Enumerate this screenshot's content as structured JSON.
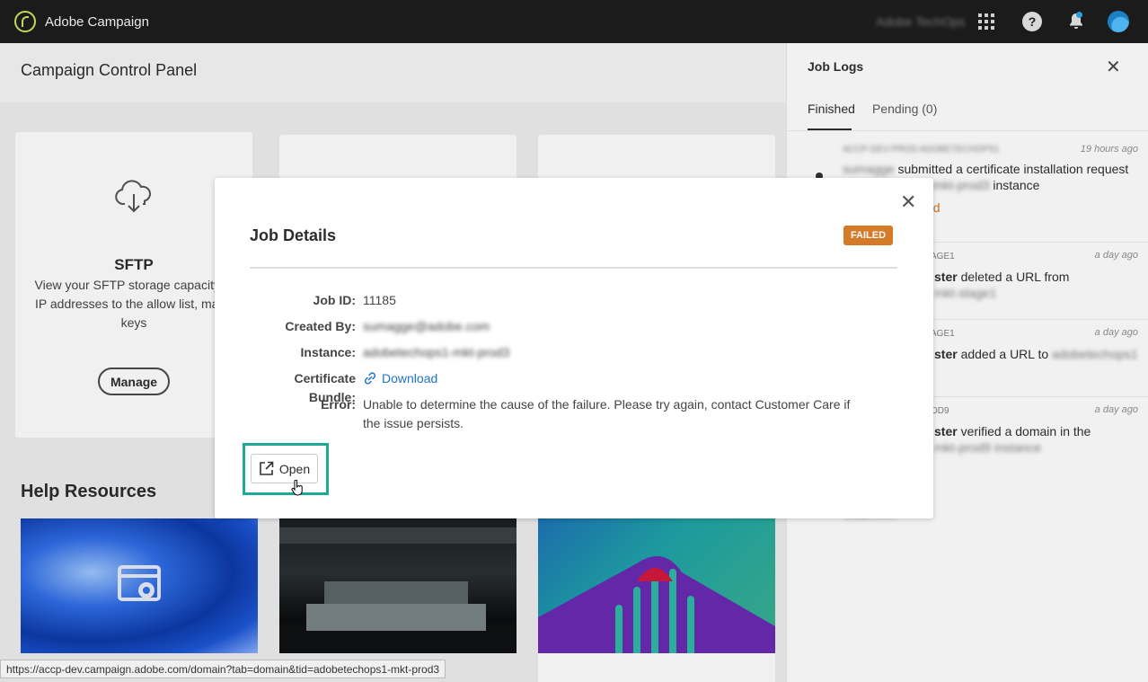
{
  "topbar": {
    "app_title": "Adobe Campaign",
    "org_name": "Adobe TechOps",
    "icons": [
      "app-switcher-icon",
      "help-icon",
      "bell-icon",
      "avatar"
    ]
  },
  "main": {
    "panel_title": "Campaign Control Panel",
    "sftp_card": {
      "title": "SFTP",
      "description": "View your SFTP storage capacity, a IP addresses to the allow list, mana keys",
      "button": "Manage"
    },
    "help_resources_title": "Help Resources"
  },
  "job_logs": {
    "title": "Job Logs",
    "tabs": [
      {
        "label": "Finished"
      },
      {
        "label": "Pending (0)"
      }
    ],
    "entries": [
      {
        "header": "ACCP-DEV-PROD ADOBETECHOPS1",
        "time": "19 hours ago",
        "user": "sumagge",
        "text_start": "submitted a certificate installation request",
        "blurred_2": "adobetechops1-mkt-prod3",
        "text_end": "instance",
        "status": "ed"
      },
      {
        "header": "AGE1",
        "time": "a day ago",
        "user": "ster",
        "text": "deleted a URL from",
        "blurred_2": "mkt-stage1"
      },
      {
        "header": "AGE1",
        "time": "a day ago",
        "user": "ster",
        "text": "added a URL to",
        "blurred_2": "adobetechops1"
      },
      {
        "header": "OD9",
        "time": "a day ago",
        "user": "ster",
        "text": "verified a domain in the",
        "blurred_2": "mkt-prod9 instance"
      }
    ],
    "more": "Load more"
  },
  "modal": {
    "title": "Job Details",
    "status_badge": "FAILED",
    "fields": {
      "job_id_label": "Job ID:",
      "job_id_value": "11185",
      "created_by_label": "Created By:",
      "created_by_value": "sumagge@adobe.com",
      "instance_label": "Instance:",
      "instance_value": "adobetechops1-mkt-prod3",
      "bundle_label": "Certificate Bundle:",
      "bundle_value": "Download",
      "error_label": "Error:",
      "error_value": "Unable to determine the cause of the failure. Please try again, contact Customer Care if the issue persists."
    },
    "open_button": "Open"
  },
  "status_bar": {
    "url": "https://accp-dev.campaign.adobe.com/domain?tab=domain&tid=adobetechops1-mkt-prod3"
  },
  "colors": {
    "failed_badge": "#d47a29",
    "highlight": "#1ea897",
    "link": "#1f72c8",
    "topbar": "#1b1b1b"
  }
}
